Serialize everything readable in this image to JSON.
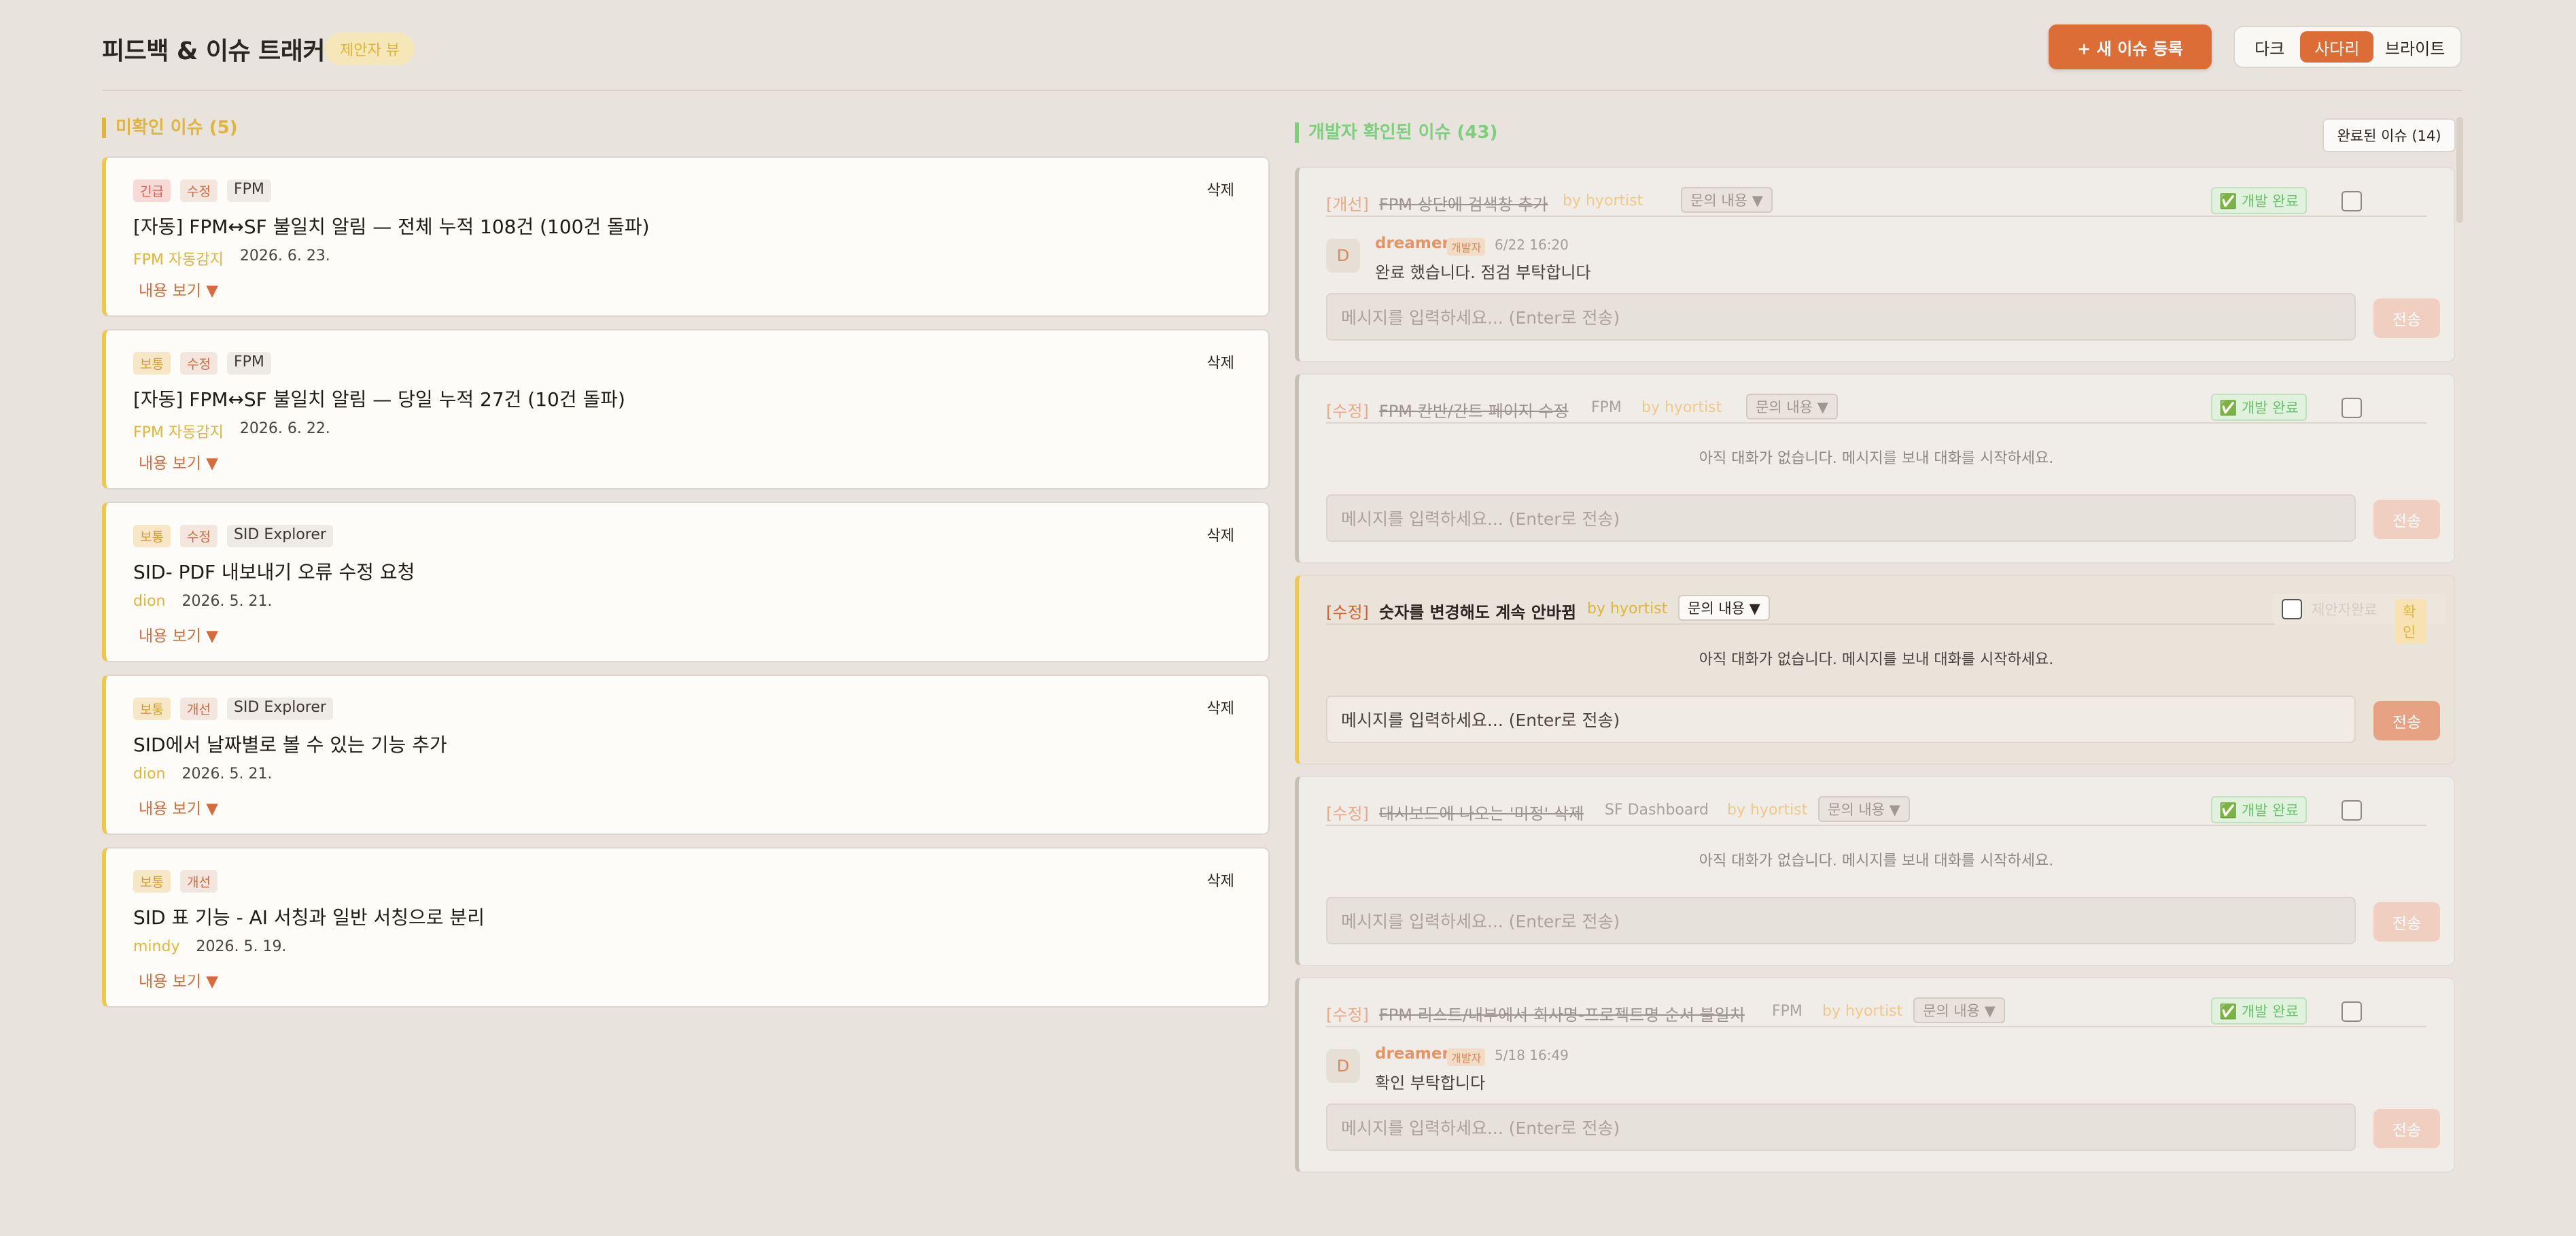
{
  "header": {
    "title": "피드백 & 이슈 트래커",
    "badge": "제안자 뷰",
    "new_issue_button": "+ 새 이슈 등록",
    "themes": [
      "다크",
      "사다리",
      "브라이트"
    ],
    "active_theme": "사다리"
  },
  "left_column": {
    "title": "미확인 이슈 (5)",
    "toggle_label": "내용 보기 ▼",
    "delete_label": "삭제",
    "cards": [
      {
        "priority": "긴급",
        "priority_kind": "urgent",
        "type": "수정",
        "project": "FPM",
        "title": "[자동] FPM↔SF 불일치 알림 — 전체 누적 108건 (100건 돌파)",
        "author": "FPM 자동감지",
        "date": "2026. 6. 23."
      },
      {
        "priority": "보통",
        "priority_kind": "normal",
        "type": "수정",
        "project": "FPM",
        "title": "[자동] FPM↔SF 불일치 알림 — 당일 누적 27건 (10건 돌파)",
        "author": "FPM 자동감지",
        "date": "2026. 6. 22."
      },
      {
        "priority": "보통",
        "priority_kind": "normal",
        "type": "수정",
        "project": "SID Explorer",
        "title": "SID- PDF 내보내기 오류 수정 요청",
        "author": "dion",
        "date": "2026. 5. 21."
      },
      {
        "priority": "보통",
        "priority_kind": "normal",
        "type": "개선",
        "project": "SID Explorer",
        "title": "SID에서 날짜별로 볼 수 있는 기능 추가",
        "author": "dion",
        "date": "2026. 5. 21."
      },
      {
        "priority": "보통",
        "priority_kind": "normal",
        "type": "개선",
        "project": "",
        "title": "SID 표 기능 - AI 서칭과 일반 서칭으로 분리",
        "author": "mindy",
        "date": "2026. 5. 19."
      }
    ]
  },
  "right_column": {
    "title": "개발자 확인된 이슈 (43)",
    "completed_button": "완료된 이슈 (14)",
    "inquiry_label": "문의 내용 ▼",
    "dev_done_label": "✅ 개발 완료",
    "input_placeholder": "메시지를 입력하세요... (Enter로 전송)",
    "send_label": "전송",
    "empty_text": "아직 대화가 없습니다. 메시지를 보내 대화를 시작하세요.",
    "requester_done_label": "제안자완료",
    "confirm_label": "확인",
    "issues": [
      {
        "type": "[개선]",
        "title": "FPM 상단에 검색창 추가",
        "project": "",
        "by": "by hyortist",
        "message": {
          "initial": "D",
          "name": "dreamer",
          "role": "개발자",
          "time": "6/22 16:20",
          "text": "완료 했습니다. 점검 부탁합니다"
        }
      },
      {
        "type": "[수정]",
        "title": "FPM 칸반/간트 페이지 수정",
        "project": "FPM",
        "by": "by hyortist"
      },
      {
        "type": "[수정]",
        "title": "숫자를 변경해도 계속 안바뀜",
        "project": "",
        "by": "by hyortist"
      },
      {
        "type": "[수정]",
        "title": "대시보드에 나오는 '미정' 삭제",
        "project": "SF Dashboard",
        "by": "by hyortist"
      },
      {
        "type": "[수정]",
        "title": "FPM 리스트/내부에서 회사명-프로젝트명 순서 불일치",
        "project": "FPM",
        "by": "by hyortist",
        "message": {
          "initial": "D",
          "name": "dreamer",
          "role": "개발자",
          "time": "5/18 16:49",
          "text": "확인 부탁합니다"
        }
      }
    ]
  }
}
